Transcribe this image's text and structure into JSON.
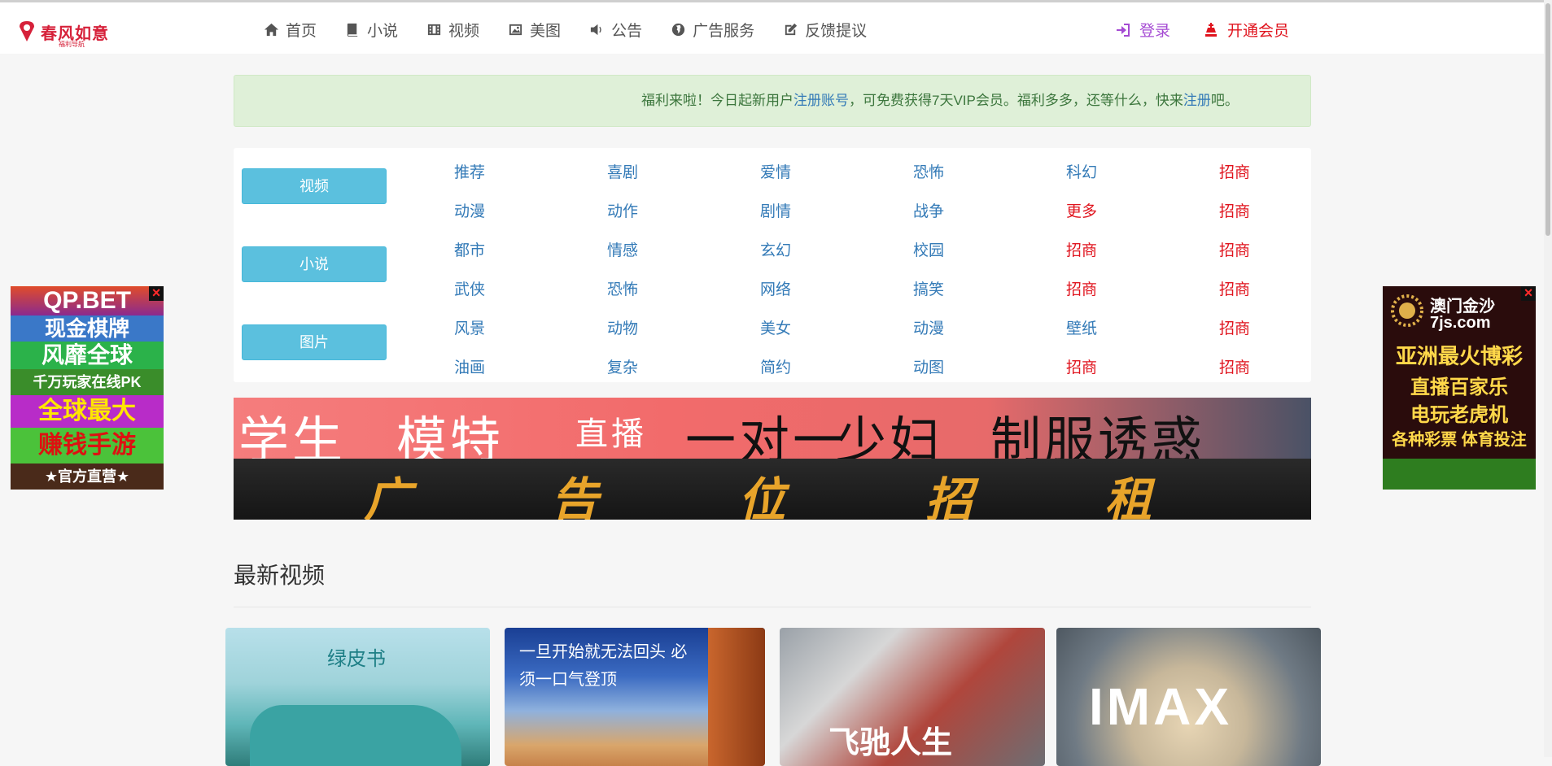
{
  "brand": {
    "name": "春风如意",
    "tagline": "福利导航"
  },
  "nav": [
    {
      "label": "首页",
      "icon": "home-icon"
    },
    {
      "label": "小说",
      "icon": "book-icon"
    },
    {
      "label": "视频",
      "icon": "film-icon"
    },
    {
      "label": "美图",
      "icon": "image-icon"
    },
    {
      "label": "公告",
      "icon": "speaker-icon"
    },
    {
      "label": "广告服务",
      "icon": "globe-icon"
    },
    {
      "label": "反馈提议",
      "icon": "edit-icon"
    }
  ],
  "account": {
    "login": "登录",
    "vip": "开通会员"
  },
  "notice": {
    "part1": "福利来啦！今日起新用户",
    "link1": "注册账号",
    "part2": "，可免费获得7天VIP会员。福利多多，还等什么，快来",
    "link2": "注册",
    "part3": "吧。"
  },
  "categories": {
    "buttons": [
      "视频",
      "小说",
      "图片"
    ],
    "rows": [
      [
        "推荐",
        "喜剧",
        "爱情",
        "恐怖",
        "科幻",
        "招商"
      ],
      [
        "动漫",
        "动作",
        "剧情",
        "战争",
        "更多",
        "招商"
      ],
      [
        "都市",
        "情感",
        "玄幻",
        "校园",
        "招商",
        "招商"
      ],
      [
        "武侠",
        "恐怖",
        "网络",
        "搞笑",
        "招商",
        "招商"
      ],
      [
        "风景",
        "动物",
        "美女",
        "动漫",
        "壁纸",
        "招商"
      ],
      [
        "油画",
        "复杂",
        "简约",
        "动图",
        "招商",
        "招商"
      ]
    ],
    "red_cells": [
      [
        1,
        4
      ],
      [
        0,
        5
      ],
      [
        1,
        5
      ],
      [
        2,
        4
      ],
      [
        2,
        5
      ],
      [
        3,
        4
      ],
      [
        3,
        5
      ],
      [
        4,
        5
      ],
      [
        5,
        4
      ],
      [
        5,
        5
      ]
    ]
  },
  "banner": {
    "top_text": [
      "学生",
      "模特",
      "直播",
      "一对一",
      "少妇",
      "制服诱惑"
    ],
    "bottom_text": [
      "广",
      "告",
      "位",
      "招",
      "租"
    ]
  },
  "section": {
    "title": "最新视频"
  },
  "videos": [
    {
      "title_text": "绿皮书"
    },
    {
      "title_text": "一旦开始就无法回头 必须一口气登顶"
    },
    {
      "title_text": "飞驰人生"
    },
    {
      "title_text": "IMAX"
    }
  ],
  "left_ad": {
    "lines": [
      "QP.BET",
      "现金棋牌",
      "风靡全球",
      "千万玩家在线PK",
      "全球最大",
      "赚钱手游",
      "★官方直营★"
    ]
  },
  "right_ad": {
    "lines": [
      "澳门金沙",
      "7js.com",
      "亚洲最火博彩",
      "直播百家乐",
      "电玩老虎机",
      "各种彩票 体育投注"
    ]
  },
  "colors": {
    "accent": "#5bc0de",
    "link": "#337ab7",
    "red": "#e0141e",
    "login": "#a54bd3"
  }
}
